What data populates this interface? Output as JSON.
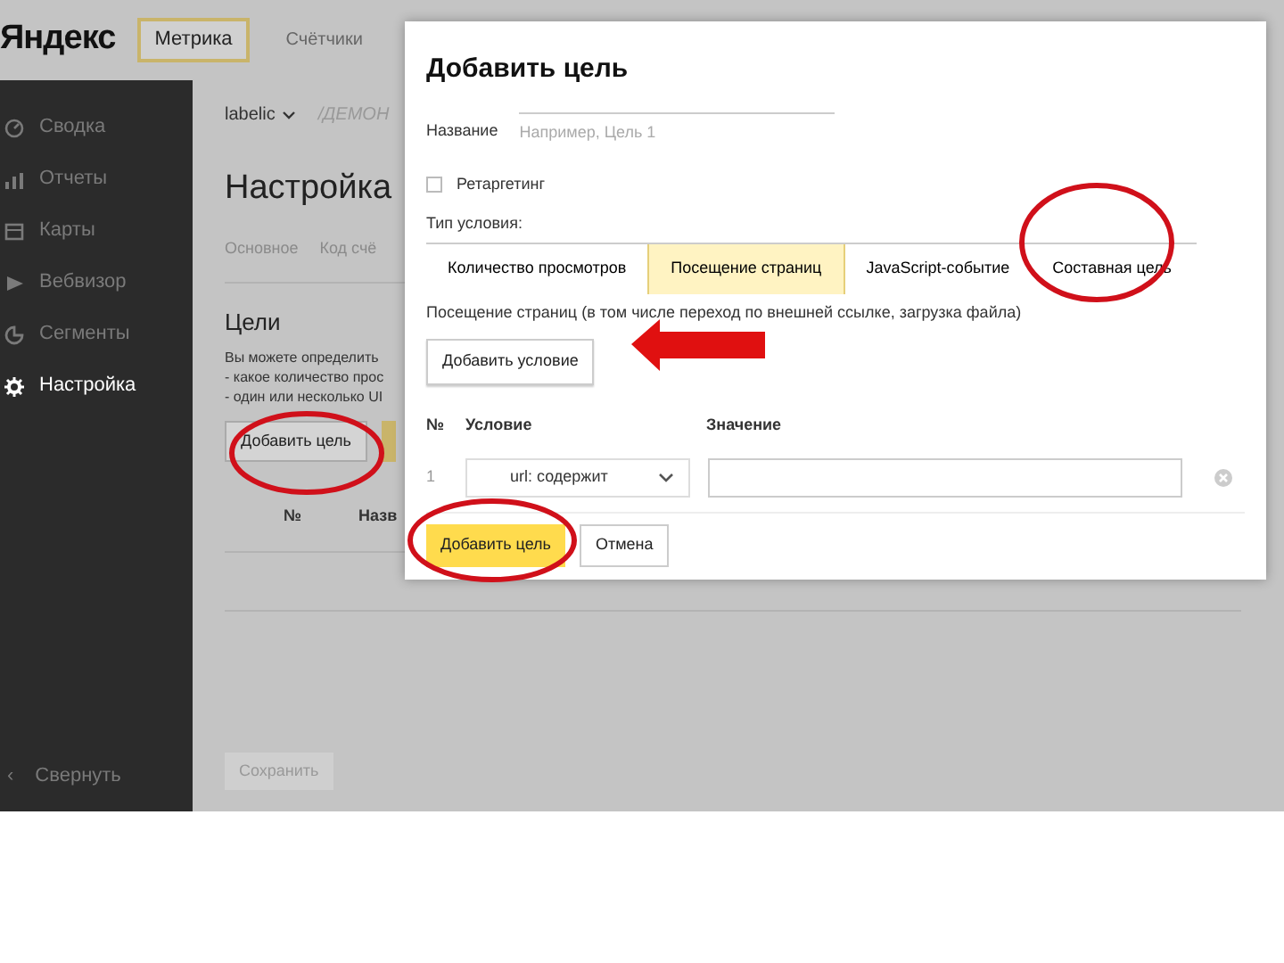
{
  "header": {
    "logo": "Яндекс",
    "product": "Метрика",
    "nav": "Счётчики"
  },
  "sidebar": {
    "items": [
      {
        "label": "Сводка",
        "selected": false
      },
      {
        "label": "Отчеты",
        "selected": false
      },
      {
        "label": "Карты",
        "selected": false
      },
      {
        "label": "Вебвизор",
        "selected": false
      },
      {
        "label": "Сегменты",
        "selected": false
      },
      {
        "label": "Настройка",
        "selected": true
      }
    ],
    "collapse": {
      "arrow": "‹",
      "label": "Свернуть"
    }
  },
  "page": {
    "counter": "labelic",
    "crumb": "/ДЕМОН",
    "title": "Настройка",
    "tabs": [
      {
        "label": "Основное",
        "selected": false
      },
      {
        "label": "Код счё",
        "selected": false
      }
    ],
    "goals": {
      "heading": "Цели",
      "lines": [
        "Вы можете определить",
        "- какое количество прос",
        "- один или несколько UI"
      ],
      "add_button": "Добавить цель",
      "columns": [
        "№",
        "Назв"
      ]
    },
    "save_button": "Сохранить"
  },
  "modal": {
    "title": "Добавить цель",
    "name_label": "Название",
    "name_placeholder": "Например, Цель 1",
    "retargeting": {
      "label": "Ретаргетинг",
      "checked": false
    },
    "type_label": "Тип условия:",
    "types": [
      {
        "label": "Количество просмотров",
        "selected": false
      },
      {
        "label": "Посещение страниц",
        "selected": true
      },
      {
        "label": "JavaScript-событие",
        "selected": false
      },
      {
        "label": "Составная цель",
        "selected": false
      }
    ],
    "description": "Посещение страниц (в том числе переход по внешней ссылке, загрузка файла)",
    "add_condition": "Добавить условие",
    "columns": [
      "№",
      "Условие",
      "Значение"
    ],
    "rows": [
      {
        "number": "1",
        "condition": "url: содержит"
      }
    ],
    "submit": "Добавить цель",
    "cancel": "Отмена"
  }
}
